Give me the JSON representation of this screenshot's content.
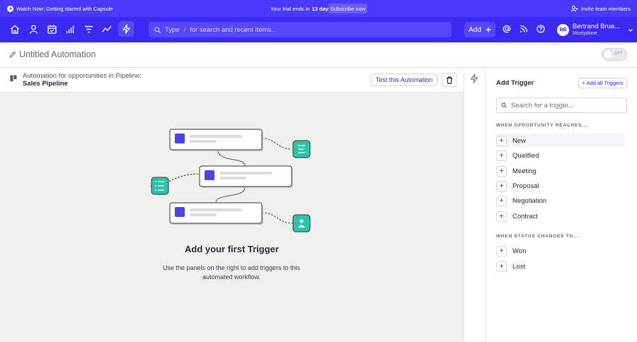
{
  "promo": {
    "watch_text": "Watch Now: Getting started with Capsule",
    "trial_prefix": "Your trial ends in",
    "trial_days": "13 days",
    "subscribe_label": "Subscribe now",
    "invite_label": "Invite team members"
  },
  "nav": {
    "search_type": "Type",
    "search_slash": "/",
    "search_placeholder": "for search and recent items...",
    "add_label": "Add",
    "user_initials": "BB",
    "user_name": "Bertrand Brua...",
    "user_org": "Nicelydone",
    "icons": [
      "home-icon",
      "person-icon",
      "calendar-icon",
      "bar-chart-icon",
      "filter-icon",
      "line-chart-icon",
      "automation-icon"
    ]
  },
  "automation": {
    "title": "Untitled Automation",
    "toggle_label": "OFF",
    "pipeline_prefix": "Automation for opportunities in Pipeline:",
    "pipeline_name": "Sales Pipeline",
    "test_label": "Test this Automation"
  },
  "empty_state": {
    "title": "Add your first Trigger",
    "description": "Use the panels on the right to add triggers to this automated workflow."
  },
  "panel": {
    "title": "Add Trigger",
    "add_all_label": "+ Add all Triggers",
    "search_placeholder": "Search for a trigger...",
    "section_opportunity": "WHEN OPPORTUNITY REACHES...",
    "opportunity_items": [
      "New",
      "Qualified",
      "Meeting",
      "Proposal",
      "Negotiation",
      "Contract"
    ],
    "section_status": "WHEN STATUS CHANGES TO...",
    "status_items": [
      "Won",
      "Lost"
    ]
  },
  "colors": {
    "brand": "#3b28f5",
    "teal": "#2bc4a8",
    "node_square": "#4a45e0"
  }
}
